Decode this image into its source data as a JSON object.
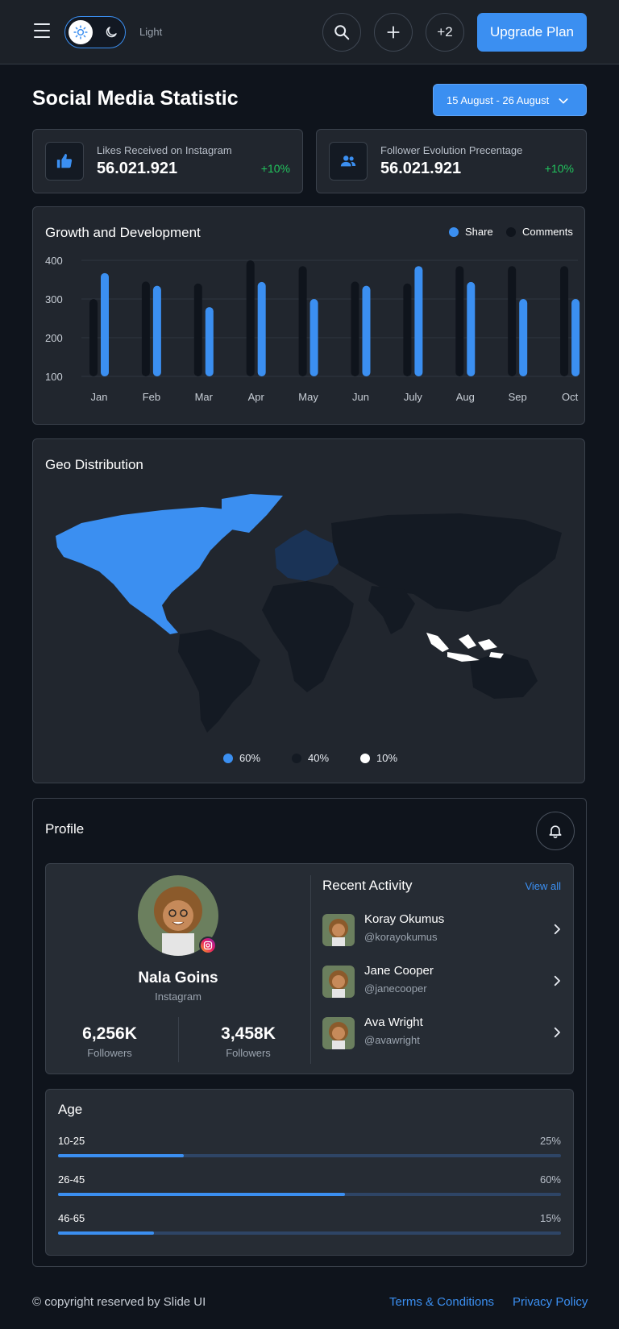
{
  "header": {
    "theme_label": "Light",
    "extra_count": "+2",
    "upgrade_label": "Upgrade Plan"
  },
  "page": {
    "title": "Social Media Statistic",
    "date_range": "15 August - 26 August"
  },
  "stats": [
    {
      "label": "Likes Received on Instagram",
      "value": "56.021.921",
      "change": "+10%",
      "icon": "thumbs-up-icon"
    },
    {
      "label": "Follower Evolution Precentage",
      "value": "56.021.921",
      "change": "+10%",
      "icon": "users-icon"
    }
  ],
  "growth": {
    "title": "Growth and Development",
    "legend_share": "Share",
    "legend_comments": "Comments"
  },
  "chart_data": {
    "type": "bar",
    "categories": [
      "Jan",
      "Feb",
      "Mar",
      "Apr",
      "May",
      "Jun",
      "July",
      "Aug",
      "Sep",
      "Oct"
    ],
    "series": [
      {
        "name": "Comments",
        "color": "#0f141c",
        "values": [
          300,
          345,
          340,
          400,
          385,
          345,
          340,
          385,
          385,
          385
        ]
      },
      {
        "name": "Share",
        "color": "#3b8ff1",
        "values": [
          367,
          334,
          279,
          344,
          300,
          334,
          385,
          344,
          300,
          300
        ]
      }
    ],
    "yticks": [
      "400",
      "300",
      "200",
      "100"
    ],
    "ylim": [
      100,
      400
    ],
    "grid": true,
    "legend_position": "top-right"
  },
  "geo": {
    "title": "Geo Distribution",
    "legend": [
      {
        "label": "60%",
        "color": "#3b8ff1"
      },
      {
        "label": "40%",
        "color": "#141a23"
      },
      {
        "label": "10%",
        "color": "#ffffff"
      }
    ]
  },
  "profile": {
    "title": "Profile",
    "name": "Nala Goins",
    "platform": "Instagram",
    "followers": [
      {
        "value": "6,256K",
        "label": "Followers"
      },
      {
        "value": "3,458K",
        "label": "Followers"
      }
    ],
    "activity_title": "Recent Activity",
    "view_all": "View all",
    "activity": [
      {
        "name": "Koray Okumus",
        "handle": "@korayokumus"
      },
      {
        "name": "Jane Cooper",
        "handle": "@janecooper"
      },
      {
        "name": "Ava Wright",
        "handle": "@avawright"
      }
    ]
  },
  "age": {
    "title": "Age",
    "groups": [
      {
        "range": "10-25",
        "pct": "25%",
        "fraction": 0.25
      },
      {
        "range": "26-45",
        "pct": "60%",
        "fraction": 0.57
      },
      {
        "range": "46-65",
        "pct": "15%",
        "fraction": 0.19
      }
    ]
  },
  "footer": {
    "copyright": "© copyright reserved by Slide UI",
    "terms": "Terms & Conditions",
    "privacy": "Privacy Policy"
  }
}
